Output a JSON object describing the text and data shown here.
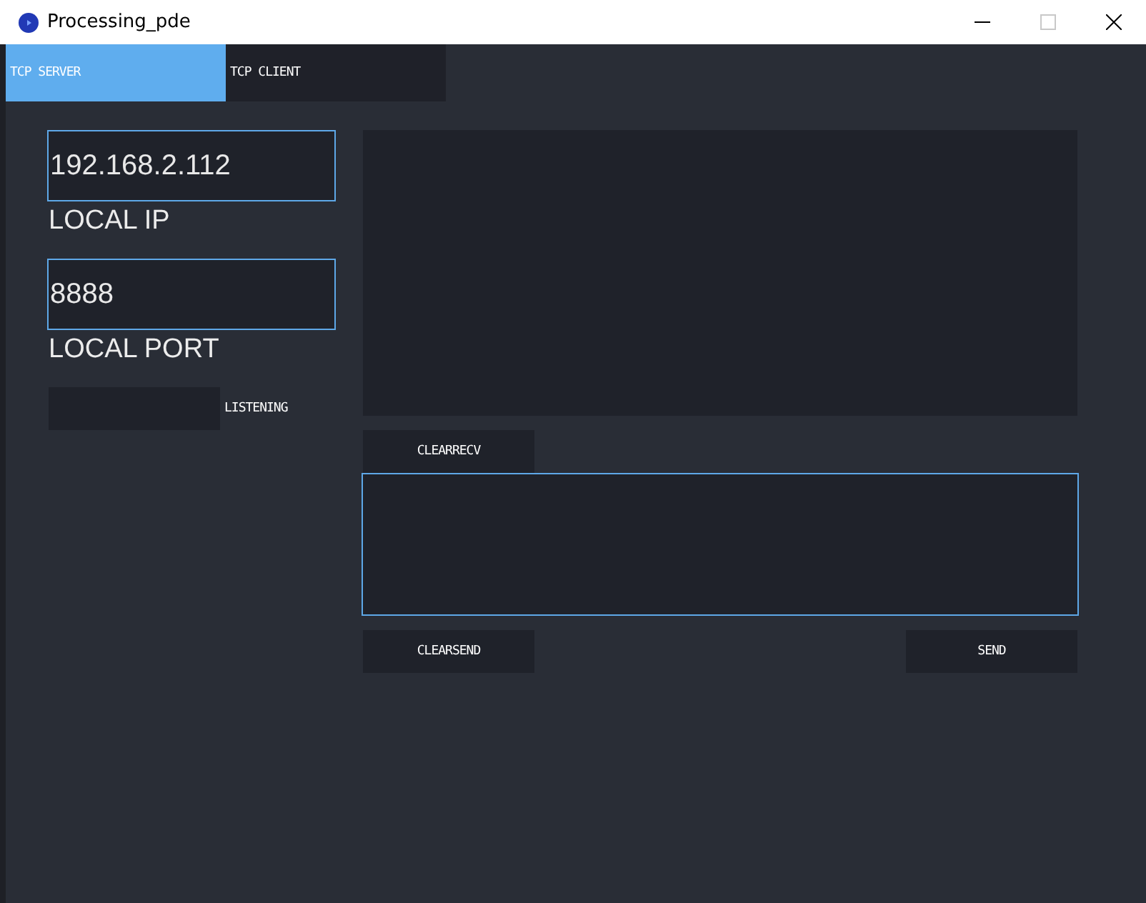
{
  "window": {
    "title": "Processing_pde",
    "maximize_disabled": true
  },
  "tabs": [
    {
      "label": "TCP SERVER",
      "selected": true
    },
    {
      "label": "TCP CLIENT",
      "selected": false
    }
  ],
  "local_ip": {
    "value": "192.168.2.112",
    "label": "LOCAL IP"
  },
  "local_port": {
    "value": "8888",
    "label": "LOCAL PORT"
  },
  "listening": {
    "label": "LISTENING",
    "on": false
  },
  "clear_recv_button": "CLEARRECV",
  "clear_send_button": "CLEARSEND",
  "send_button": "SEND"
}
